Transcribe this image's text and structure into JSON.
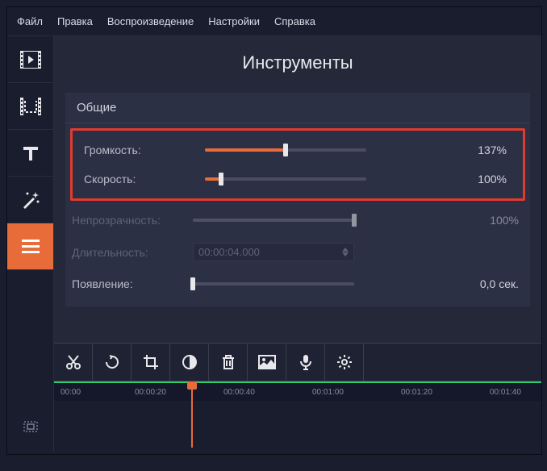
{
  "menu": {
    "file": "Файл",
    "edit": "Правка",
    "playback": "Воспроизведение",
    "settings": "Настройки",
    "help": "Справка"
  },
  "title": "Инструменты",
  "panel": {
    "header": "Общие",
    "volume": {
      "label": "Громкость:",
      "value": "137%",
      "fill": 50
    },
    "speed": {
      "label": "Скорость:",
      "value": "100%",
      "fill": 10
    },
    "opacity": {
      "label": "Непрозрачность:",
      "value": "100%",
      "fill": 100
    },
    "duration": {
      "label": "Длительность:",
      "value": "00:00:04.000"
    },
    "appearance": {
      "label": "Появление:",
      "value": "0,0 сек.",
      "fill": 0
    }
  },
  "ruler": {
    "t0": "00:00",
    "t1": "00:00:20",
    "t2": "00:00:40",
    "t3": "00:01:00",
    "t4": "00:01:20",
    "t5": "00:01:40"
  }
}
